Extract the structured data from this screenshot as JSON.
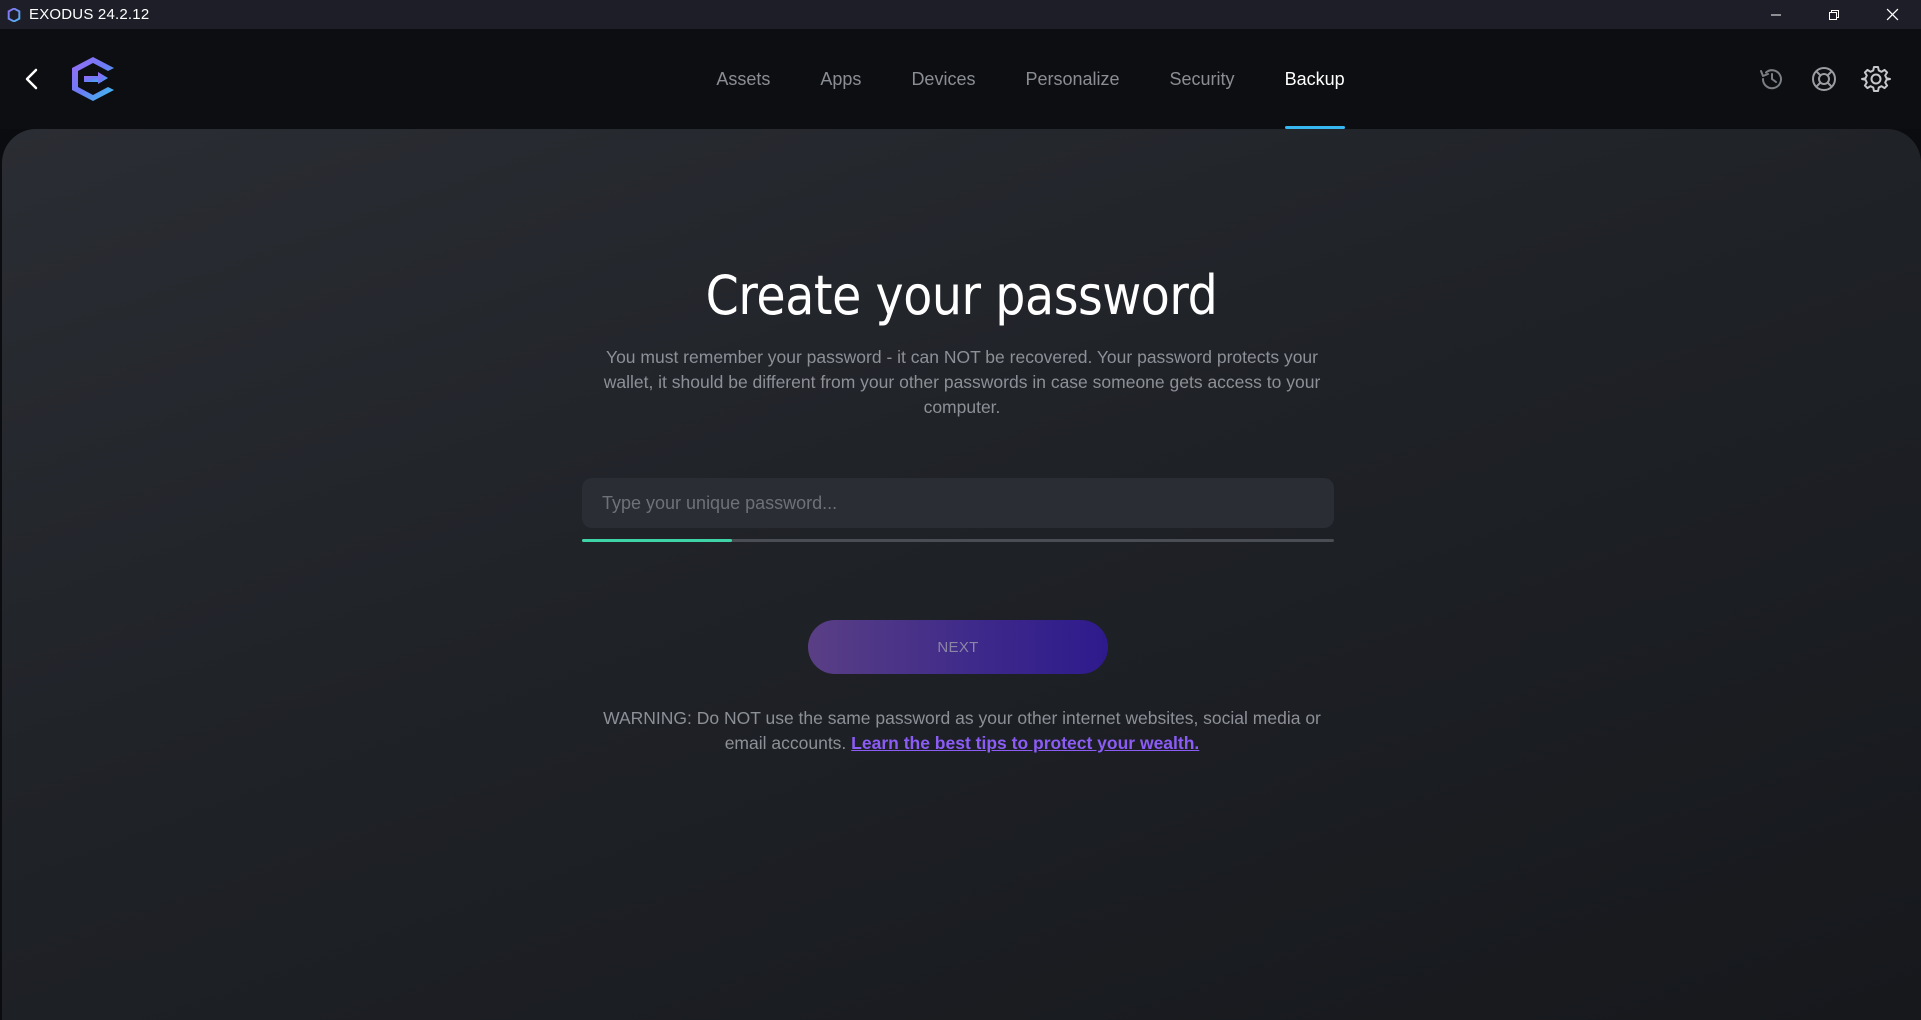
{
  "window": {
    "title": "EXODUS 24.2.12"
  },
  "header": {
    "nav": [
      {
        "label": "Assets"
      },
      {
        "label": "Apps"
      },
      {
        "label": "Devices"
      },
      {
        "label": "Personalize"
      },
      {
        "label": "Security"
      },
      {
        "label": "Backup",
        "active": true
      }
    ],
    "icons": [
      "history-icon",
      "support-icon",
      "settings-icon"
    ]
  },
  "main": {
    "title": "Create your password",
    "description": "You must remember your password - it can NOT be recovered. Your password protects your wallet, it should be different from your other passwords in case someone gets access to your computer.",
    "password": {
      "placeholder": "Type your unique password...",
      "value": "",
      "strength_fraction": 0.2
    },
    "next_label": "NEXT",
    "warning_text": "WARNING: Do NOT use the same password as your other internet websites, social media or email accounts.",
    "warning_link": "Learn the best tips to protect your wealth."
  },
  "colors": {
    "accent_blue": "#37b7f0",
    "strength_green": "#3fd4a8",
    "link_purple": "#8b5cf6",
    "button_gradient_start": "#5a3f85",
    "button_gradient_end": "#2e1a8c"
  }
}
